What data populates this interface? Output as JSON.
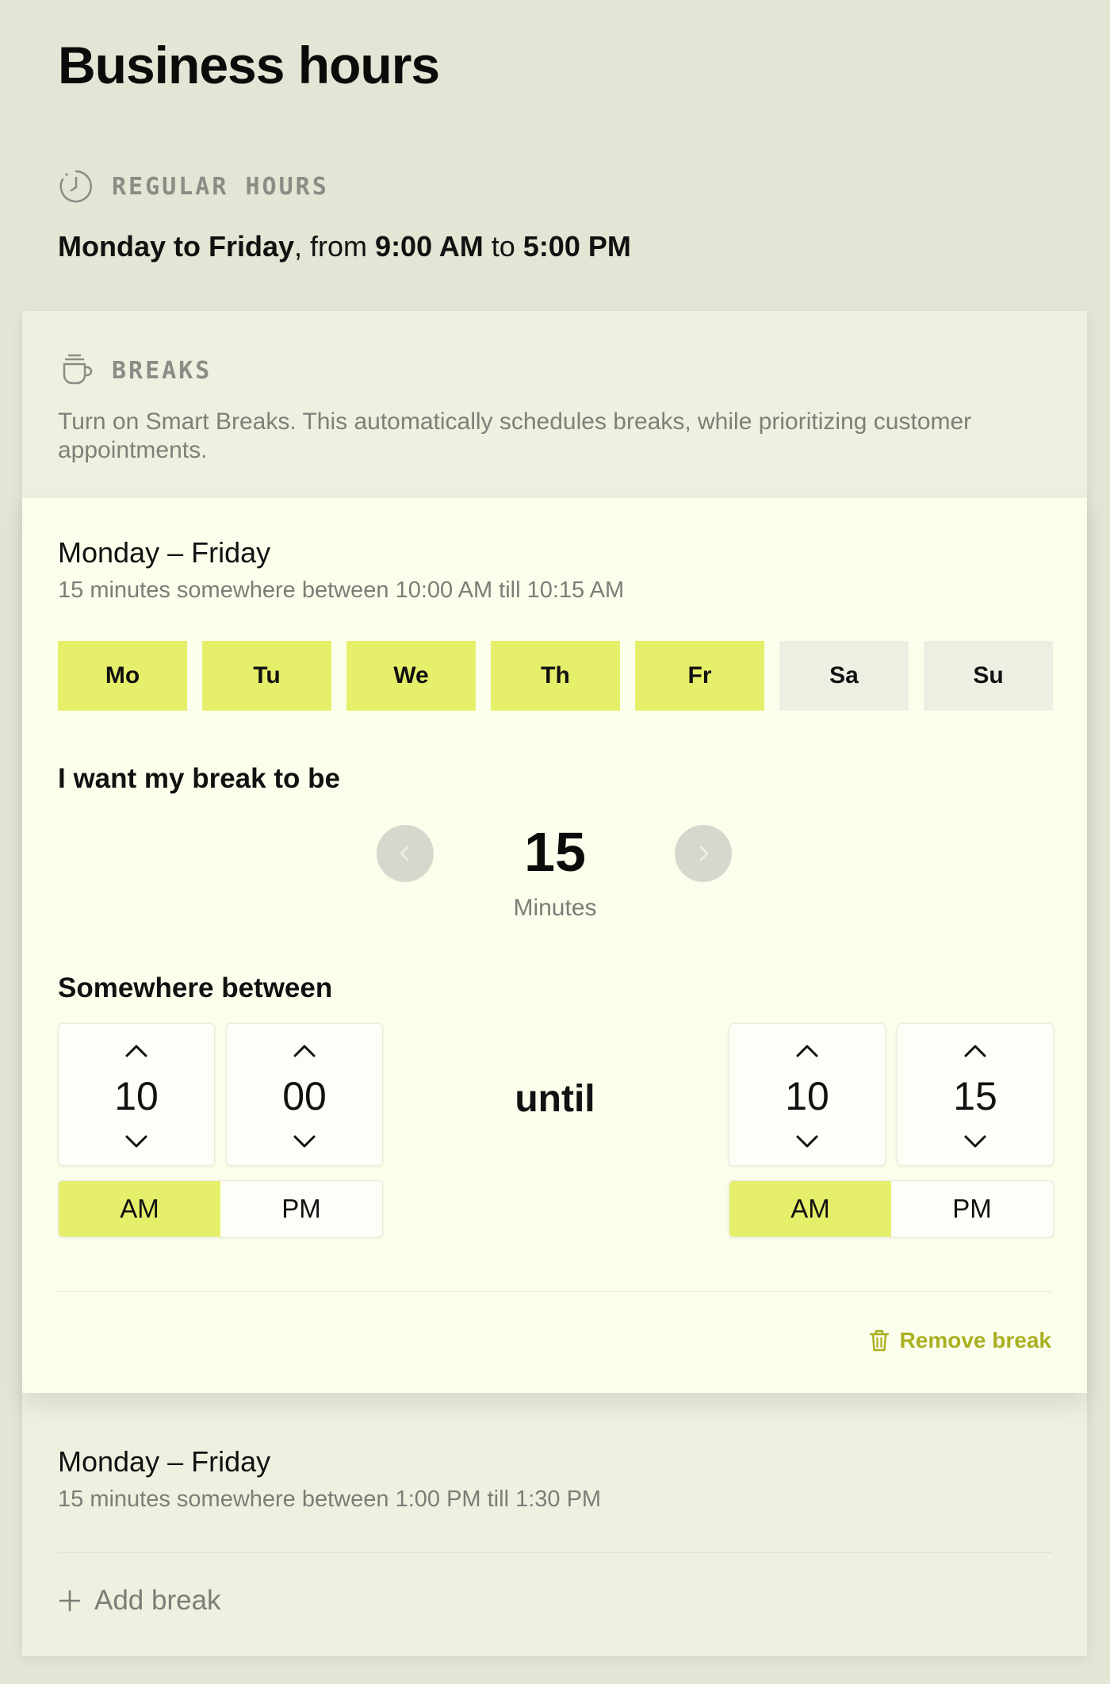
{
  "page": {
    "title": "Business hours"
  },
  "regular": {
    "label": "REGULAR HOURS",
    "days": "Monday to Friday",
    "from_word": ", from ",
    "start": "9:00 AM",
    "to_word": " to ",
    "end": "5:00 PM",
    "icon": "clock-icon"
  },
  "breaks": {
    "label": "BREAKS",
    "icon": "coffee-cup-icon",
    "description": "Turn on Smart Breaks. This automatically schedules breaks, while prioritizing customer appointments.",
    "active": {
      "title": "Monday – Friday",
      "subtitle": "15 minutes somewhere between 10:00 AM till 10:15 AM",
      "days": [
        {
          "label": "Mo",
          "selected": true
        },
        {
          "label": "Tu",
          "selected": true
        },
        {
          "label": "We",
          "selected": true
        },
        {
          "label": "Th",
          "selected": true
        },
        {
          "label": "Fr",
          "selected": true
        },
        {
          "label": "Sa",
          "selected": false
        },
        {
          "label": "Su",
          "selected": false
        }
      ],
      "duration_label": "I want my break to be",
      "duration_value": "15",
      "duration_unit": "Minutes",
      "between_label": "Somewhere between",
      "start_hour": "10",
      "start_minute": "00",
      "until_label": "until",
      "end_hour": "10",
      "end_minute": "15",
      "am_label": "AM",
      "pm_label": "PM",
      "start_period": "AM",
      "end_period": "AM",
      "remove_label": "Remove break"
    },
    "second": {
      "title": "Monday – Friday",
      "subtitle": "15 minutes somewhere between 1:00 PM till 1:30 PM"
    },
    "add_label": "Add break"
  },
  "colors": {
    "page_bg": "#e3e6d4",
    "accent": "#e6ef6a",
    "remove": "#a9b021"
  }
}
